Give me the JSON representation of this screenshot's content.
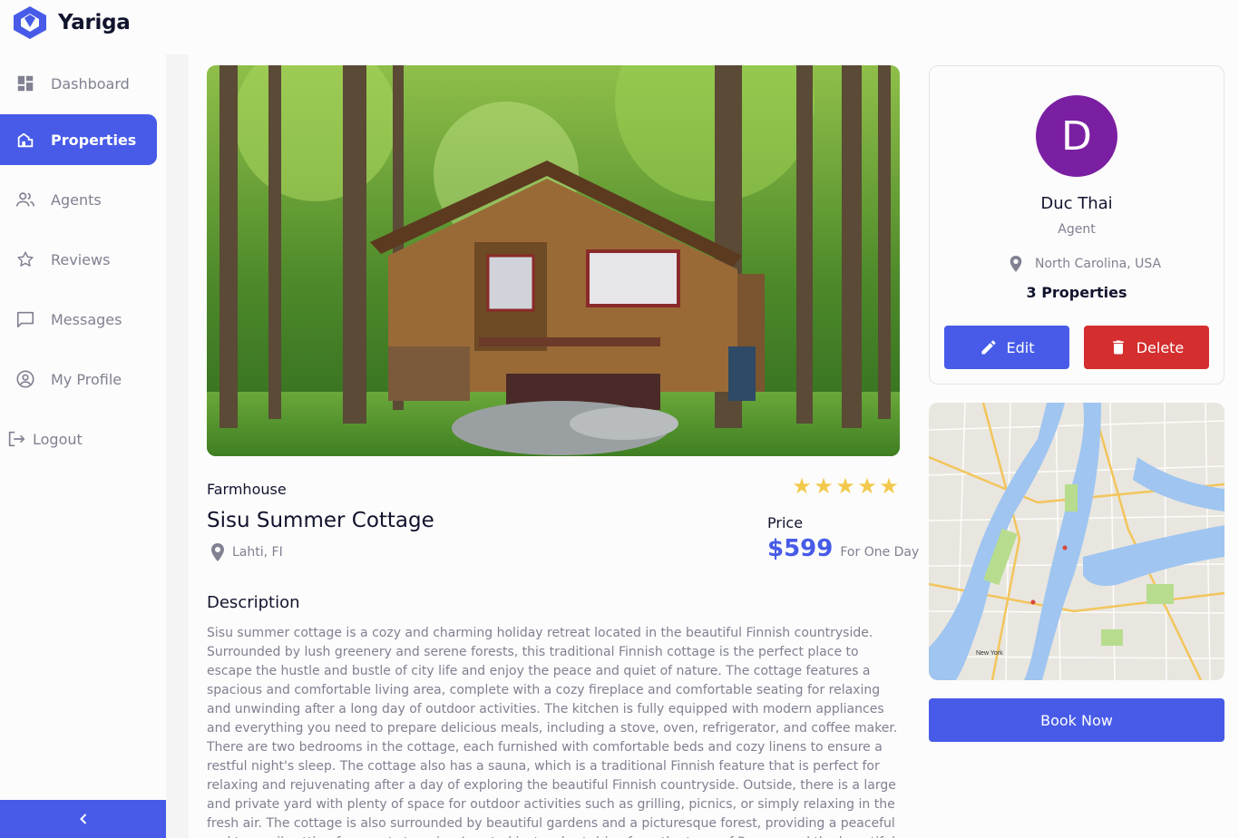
{
  "app": {
    "name": "Yariga"
  },
  "sidebar": {
    "items": [
      {
        "label": "Dashboard",
        "icon": "dashboard-icon"
      },
      {
        "label": "Properties",
        "icon": "properties-icon",
        "active": true
      },
      {
        "label": "Agents",
        "icon": "agents-icon"
      },
      {
        "label": "Reviews",
        "icon": "star-outline-icon"
      },
      {
        "label": "Messages",
        "icon": "chat-icon"
      },
      {
        "label": "My Profile",
        "icon": "account-circle-icon"
      }
    ],
    "logout_label": "Logout",
    "collapse_icon": "chevron-left-icon"
  },
  "property": {
    "image_alt": "Wooden cottage in a forest",
    "type": "Farmhouse",
    "rating": 5,
    "title": "Sisu Summer Cottage",
    "location": "Lahti, FI",
    "price_label": "Price",
    "price": "$599",
    "price_unit": "For One Day",
    "description_title": "Description",
    "description": "Sisu summer cottage is a cozy and charming holiday retreat located in the beautiful Finnish countryside. Surrounded by lush greenery and serene forests, this traditional Finnish cottage is the perfect place to escape the hustle and bustle of city life and enjoy the peace and quiet of nature. The cottage features a spacious and comfortable living area, complete with a cozy fireplace and comfortable seating for relaxing and unwinding after a long day of outdoor activities. The kitchen is fully equipped with modern appliances and everything you need to prepare delicious meals, including a stove, oven, refrigerator, and coffee maker. There are two bedrooms in the cottage, each furnished with comfortable beds and cozy linens to ensure a restful night's sleep. The cottage also has a sauna, which is a traditional Finnish feature that is perfect for relaxing and rejuvenating after a day of exploring the beautiful Finnish countryside. Outside, there is a large and private yard with plenty of space for outdoor activities such as grilling, picnics, or simply relaxing in the fresh air. The cottage is also surrounded by beautiful gardens and a picturesque forest, providing a peaceful and tranquil setting for guests to enjoy. Located just a short drive from the town of Rauma and the beautiful Archipelago Sea, Sisu summer"
  },
  "agent": {
    "initial": "D",
    "name": "Duc Thai",
    "role": "Agent",
    "location": "North Carolina, USA",
    "properties": "3 Properties",
    "edit_label": "Edit",
    "delete_label": "Delete"
  },
  "map": {
    "city_label": "New York"
  },
  "book_label": "Book Now",
  "colors": {
    "accent": "#475be8",
    "danger": "#d42e2e",
    "avatar": "#7b1fa2",
    "star": "#f2c94c"
  }
}
